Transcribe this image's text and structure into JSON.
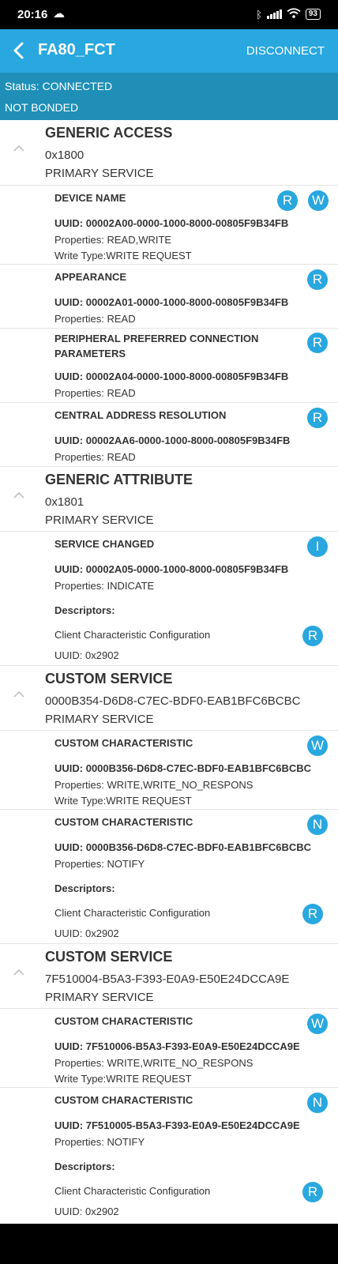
{
  "status_bar": {
    "time": "20:16",
    "battery": "93",
    "cloud_icon": "cloud-icon"
  },
  "app_bar": {
    "title": "FA80_FCT",
    "disconnect_label": "DISCONNECT"
  },
  "connection": {
    "status": "Status: CONNECTED",
    "bond": "NOT BONDED"
  },
  "services": [
    {
      "name": "GENERIC ACCESS",
      "uuid": "0x1800",
      "type": "PRIMARY SERVICE",
      "characteristics": [
        {
          "name": "DEVICE NAME",
          "uuid": "UUID: 00002A00-0000-1000-8000-00805F9B34FB",
          "properties": "Properties: READ,WRITE",
          "write_type": "Write Type:WRITE REQUEST",
          "badges": [
            "R",
            "W"
          ]
        },
        {
          "name": "APPEARANCE",
          "uuid": "UUID: 00002A01-0000-1000-8000-00805F9B34FB",
          "properties": "Properties: READ",
          "badges": [
            "R"
          ]
        },
        {
          "name": "PERIPHERAL PREFERRED CONNECTION PARAMETERS",
          "uuid": "UUID: 00002A04-0000-1000-8000-00805F9B34FB",
          "properties": "Properties: READ",
          "badges": [
            "R"
          ]
        },
        {
          "name": "CENTRAL ADDRESS RESOLUTION",
          "uuid": "UUID: 00002AA6-0000-1000-8000-00805F9B34FB",
          "properties": "Properties: READ",
          "badges": [
            "R"
          ]
        }
      ]
    },
    {
      "name": "GENERIC ATTRIBUTE",
      "uuid": "0x1801",
      "type": "PRIMARY SERVICE",
      "characteristics": [
        {
          "name": "SERVICE CHANGED",
          "uuid": "UUID: 00002A05-0000-1000-8000-00805F9B34FB",
          "properties": "Properties: INDICATE",
          "badges": [
            "I"
          ],
          "descriptors_label": "Descriptors:",
          "descriptor_name": "Client Characteristic Configuration",
          "descriptor_uuid": "UUID: 0x2902",
          "descriptor_badge": "R"
        }
      ]
    },
    {
      "name": "CUSTOM SERVICE",
      "uuid": "0000B354-D6D8-C7EC-BDF0-EAB1BFC6BCBC",
      "type": "PRIMARY SERVICE",
      "characteristics": [
        {
          "name": "CUSTOM CHARACTERISTIC",
          "uuid": "UUID: 0000B356-D6D8-C7EC-BDF0-EAB1BFC6BCBC",
          "properties": "Properties: WRITE,WRITE_NO_RESPONS",
          "write_type": "Write Type:WRITE REQUEST",
          "badges": [
            "W"
          ]
        },
        {
          "name": "CUSTOM CHARACTERISTIC",
          "uuid": "UUID: 0000B356-D6D8-C7EC-BDF0-EAB1BFC6BCBC",
          "properties": "Properties: NOTIFY",
          "badges": [
            "N"
          ],
          "descriptors_label": "Descriptors:",
          "descriptor_name": "Client Characteristic Configuration",
          "descriptor_uuid": "UUID: 0x2902",
          "descriptor_badge": "R"
        }
      ]
    },
    {
      "name": "CUSTOM SERVICE",
      "uuid": "7F510004-B5A3-F393-E0A9-E50E24DCCA9E",
      "type": "PRIMARY SERVICE",
      "characteristics": [
        {
          "name": "CUSTOM CHARACTERISTIC",
          "uuid": "UUID: 7F510006-B5A3-F393-E0A9-E50E24DCCA9E",
          "properties": "Properties: WRITE,WRITE_NO_RESPONS",
          "write_type": "Write Type:WRITE REQUEST",
          "badges": [
            "W"
          ]
        },
        {
          "name": "CUSTOM CHARACTERISTIC",
          "uuid": "UUID: 7F510005-B5A3-F393-E0A9-E50E24DCCA9E",
          "properties": "Properties: NOTIFY",
          "badges": [
            "N"
          ],
          "descriptors_label": "Descriptors:",
          "descriptor_name": "Client Characteristic Configuration",
          "descriptor_uuid": "UUID: 0x2902",
          "descriptor_badge": "R"
        }
      ]
    }
  ]
}
